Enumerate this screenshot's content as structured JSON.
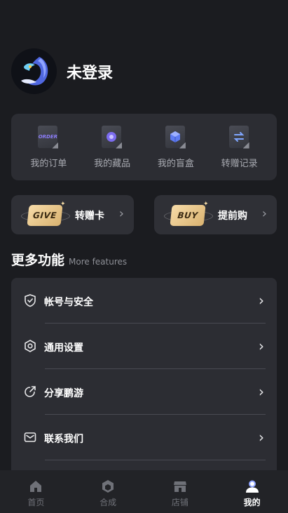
{
  "profile": {
    "username": "未登录"
  },
  "quick_actions": [
    {
      "label": "我的订单",
      "icon": "order-icon",
      "badge_text": "ORDER",
      "accent": "#8b7cf6"
    },
    {
      "label": "我的藏品",
      "icon": "collection-icon",
      "accent": "#8b7cf6"
    },
    {
      "label": "我的盲盒",
      "icon": "blind-box-icon",
      "accent": "#6f8cf8"
    },
    {
      "label": "转赠记录",
      "icon": "transfer-icon",
      "accent": "#7fa6ff"
    }
  ],
  "cards": {
    "give": {
      "badge": "GIVE",
      "label": "转赠卡"
    },
    "buy": {
      "badge": "BUY",
      "label": "提前购"
    }
  },
  "section": {
    "title_cn": "更多功能",
    "title_en": "More features"
  },
  "menu": [
    {
      "label": "帐号与安全",
      "icon": "shield-icon"
    },
    {
      "label": "通用设置",
      "icon": "settings-hexagon-icon"
    },
    {
      "label": "分享鹏游",
      "icon": "share-icon"
    },
    {
      "label": "联系我们",
      "icon": "mail-icon"
    }
  ],
  "tabs": [
    {
      "label": "首页",
      "icon": "home-icon",
      "active": false
    },
    {
      "label": "合成",
      "icon": "compose-icon",
      "active": false
    },
    {
      "label": "店铺",
      "icon": "store-icon",
      "active": false
    },
    {
      "label": "我的",
      "icon": "profile-icon",
      "active": true
    }
  ],
  "colors": {
    "background": "#1b1c20",
    "panel": "#2c2d33",
    "ticket_gold": "#e8c686",
    "tab_inactive": "#6f7178",
    "tab_active": "#ffffff"
  }
}
